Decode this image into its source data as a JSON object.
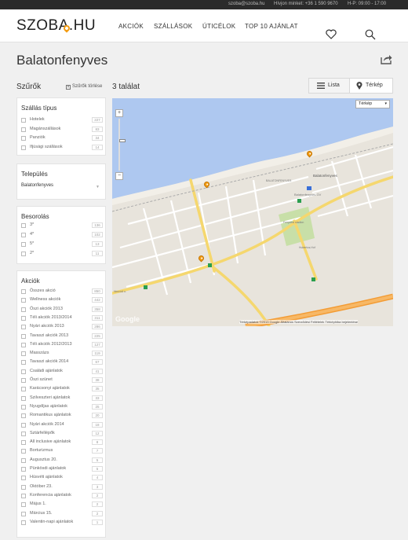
{
  "topbar": {
    "email": "szoba@szoba.hu",
    "phone": "Hívjon minket: +36 1 590 9670",
    "hours": "H-P: 09:00 - 17:00"
  },
  "header": {
    "logo": "SZOBA.HU",
    "nav": [
      "AKCIÓK",
      "SZÁLLÁSOK",
      "ÚTICÉLOK",
      "TOP 10 AJÁNLAT"
    ],
    "icons": [
      "heart-icon",
      "search-icon"
    ]
  },
  "page": {
    "title": "Balatonfenyves",
    "share_icon": "share-icon"
  },
  "filters": {
    "title": "Szűrők",
    "clear_label": "Szűrők törlése",
    "accommodation": {
      "title": "Szállás típus",
      "items": [
        {
          "label": "Hotelek",
          "count": "227"
        },
        {
          "label": "Magánszállások",
          "count": "83"
        },
        {
          "label": "Panziók",
          "count": "34"
        },
        {
          "label": "Ifjúsági szállások",
          "count": "14"
        }
      ]
    },
    "settlement": {
      "title": "Település",
      "value": "Balatonfenyves"
    },
    "rating": {
      "title": "Besorolás",
      "items": [
        {
          "label": "3*",
          "count": "136"
        },
        {
          "label": "4*",
          "count": "102"
        },
        {
          "label": "5*",
          "count": "13"
        },
        {
          "label": "2*",
          "count": "11"
        }
      ]
    },
    "deals": {
      "title": "Akciók",
      "items": [
        {
          "label": "Összes akció",
          "count": "850"
        },
        {
          "label": "Wellness akciók",
          "count": "442"
        },
        {
          "label": "Őszi akciók 2013",
          "count": "358"
        },
        {
          "label": "Téli akciók 2013/2014",
          "count": "311"
        },
        {
          "label": "Nyári akciók 2013",
          "count": "286"
        },
        {
          "label": "Tavaszi akciók 2013",
          "count": "225"
        },
        {
          "label": "Téli akciók 2012/2013",
          "count": "127"
        },
        {
          "label": "Masszázs",
          "count": "119"
        },
        {
          "label": "Tavaszi akciók 2014",
          "count": "67"
        },
        {
          "label": "Családi ajánlatok",
          "count": "41"
        },
        {
          "label": "Őszi szünet",
          "count": "38"
        },
        {
          "label": "Karácsonyi ajánlatok",
          "count": "35"
        },
        {
          "label": "Szilveszteri ajánlatok",
          "count": "33"
        },
        {
          "label": "Nyugdíjas ajánlatok",
          "count": "25"
        },
        {
          "label": "Romantikus ajánlatok",
          "count": "20"
        },
        {
          "label": "Nyári akciók 2014",
          "count": "18"
        },
        {
          "label": "Sztárfellépők",
          "count": "12"
        },
        {
          "label": "All inclusive ajánlatok",
          "count": "8"
        },
        {
          "label": "Borturizmus",
          "count": "7"
        },
        {
          "label": "Augusztus 20.",
          "count": "5"
        },
        {
          "label": "Pünkösdi ajánlatok",
          "count": "5"
        },
        {
          "label": "Húsvéti ajánlatok",
          "count": "4"
        },
        {
          "label": "Október 23.",
          "count": "3"
        },
        {
          "label": "Konferencia ajánlatok",
          "count": "2"
        },
        {
          "label": "Május 1.",
          "count": "2"
        },
        {
          "label": "Március 15.",
          "count": "2"
        },
        {
          "label": "Valentin-napi ajánlatok",
          "count": "1"
        }
      ]
    }
  },
  "results": {
    "count_label": "3 találat",
    "view_list": "Lista",
    "view_map": "Térkép"
  },
  "map": {
    "type_label": "Térkép",
    "zoom_in": "+",
    "zoom_out": "−",
    "logo": "Google",
    "attribution": "Térképadatok ©2013 Google   Általános Szerződési Feltételek   Térképhiba bejelentése",
    "colors": {
      "water": "#aec8f0",
      "land": "#e8e4dc",
      "road": "#f5d76e",
      "highway": "#f39c35",
      "park": "#c8dfa8",
      "marker": "#f39c12"
    },
    "labels": [
      "Balatonfenyves",
      "Balatonfenyves GV",
      "BALATONFENYVES",
      "Fenyvesi stadion",
      "Hubertus-Hof",
      "Nimródi u."
    ]
  }
}
